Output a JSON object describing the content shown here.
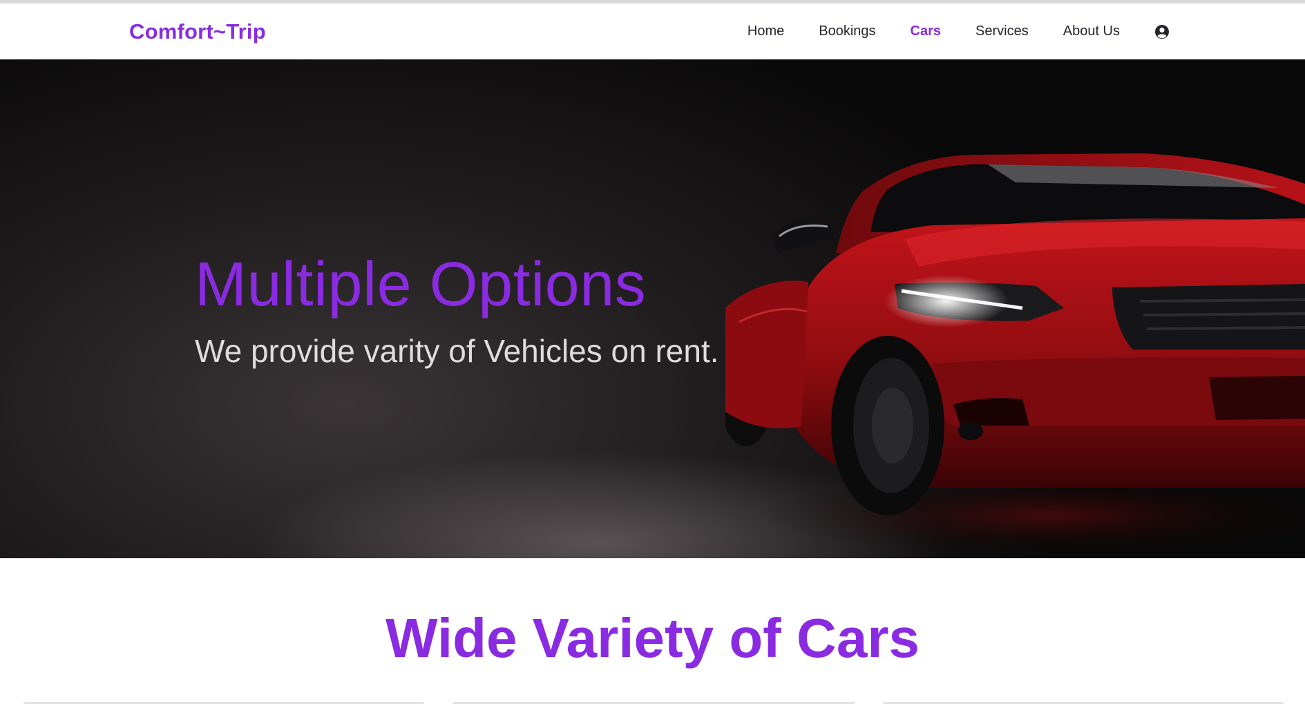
{
  "header": {
    "brand": "Comfort~Trip",
    "nav": [
      {
        "label": "Home",
        "active": false
      },
      {
        "label": "Bookings",
        "active": false
      },
      {
        "label": "Cars",
        "active": true
      },
      {
        "label": "Services",
        "active": false
      },
      {
        "label": "About Us",
        "active": false
      }
    ],
    "user_icon": "user-circle-icon"
  },
  "hero": {
    "title": "Multiple Options",
    "subtitle": "We provide varity of Vehicles on rent."
  },
  "section": {
    "title": "Wide Variety of Cars"
  },
  "colors": {
    "accent": "#8a2be2",
    "nav_text": "#24262b",
    "hero_subtitle": "#e0dcdc"
  }
}
